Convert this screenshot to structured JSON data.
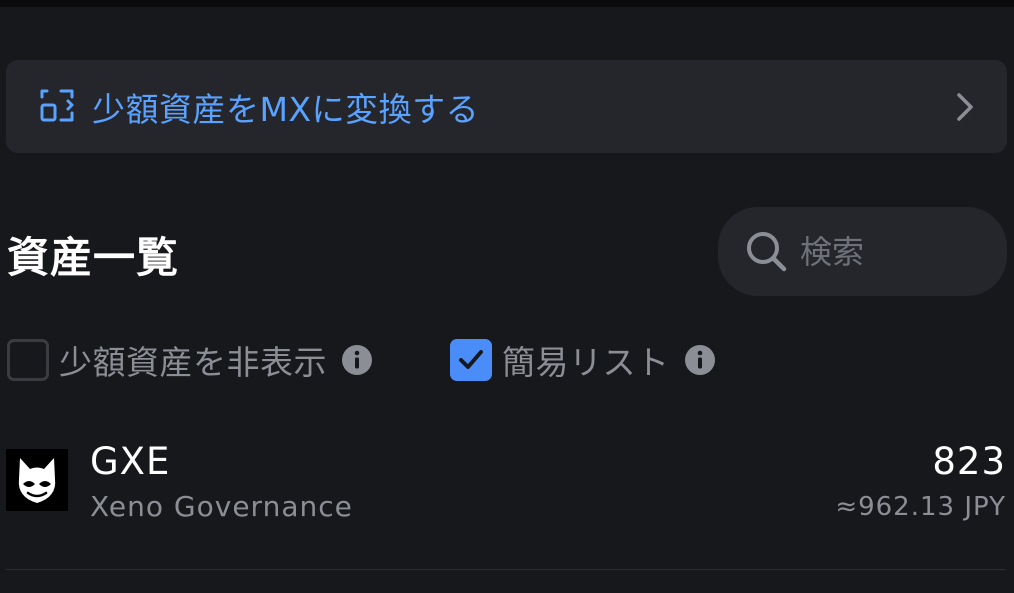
{
  "convert_banner": {
    "label": "少額資産をMXに変換する",
    "icon": "convert-icon",
    "accent_color": "#5aa2ff"
  },
  "assets_section": {
    "title": "資産一覧"
  },
  "search": {
    "placeholder": "検索",
    "value": ""
  },
  "filters": {
    "hide_small": {
      "label": "少額資産を非表示",
      "checked": false
    },
    "simple_list": {
      "label": "簡易リスト",
      "checked": true
    }
  },
  "assets": [
    {
      "symbol": "GXE",
      "name": "Xeno Governance",
      "amount": "823",
      "value": "≈962.13 JPY"
    }
  ],
  "colors": {
    "background": "#17181c",
    "card": "#24262c",
    "checkbox_checked": "#4b8df8",
    "muted_text": "#8b8e95"
  }
}
